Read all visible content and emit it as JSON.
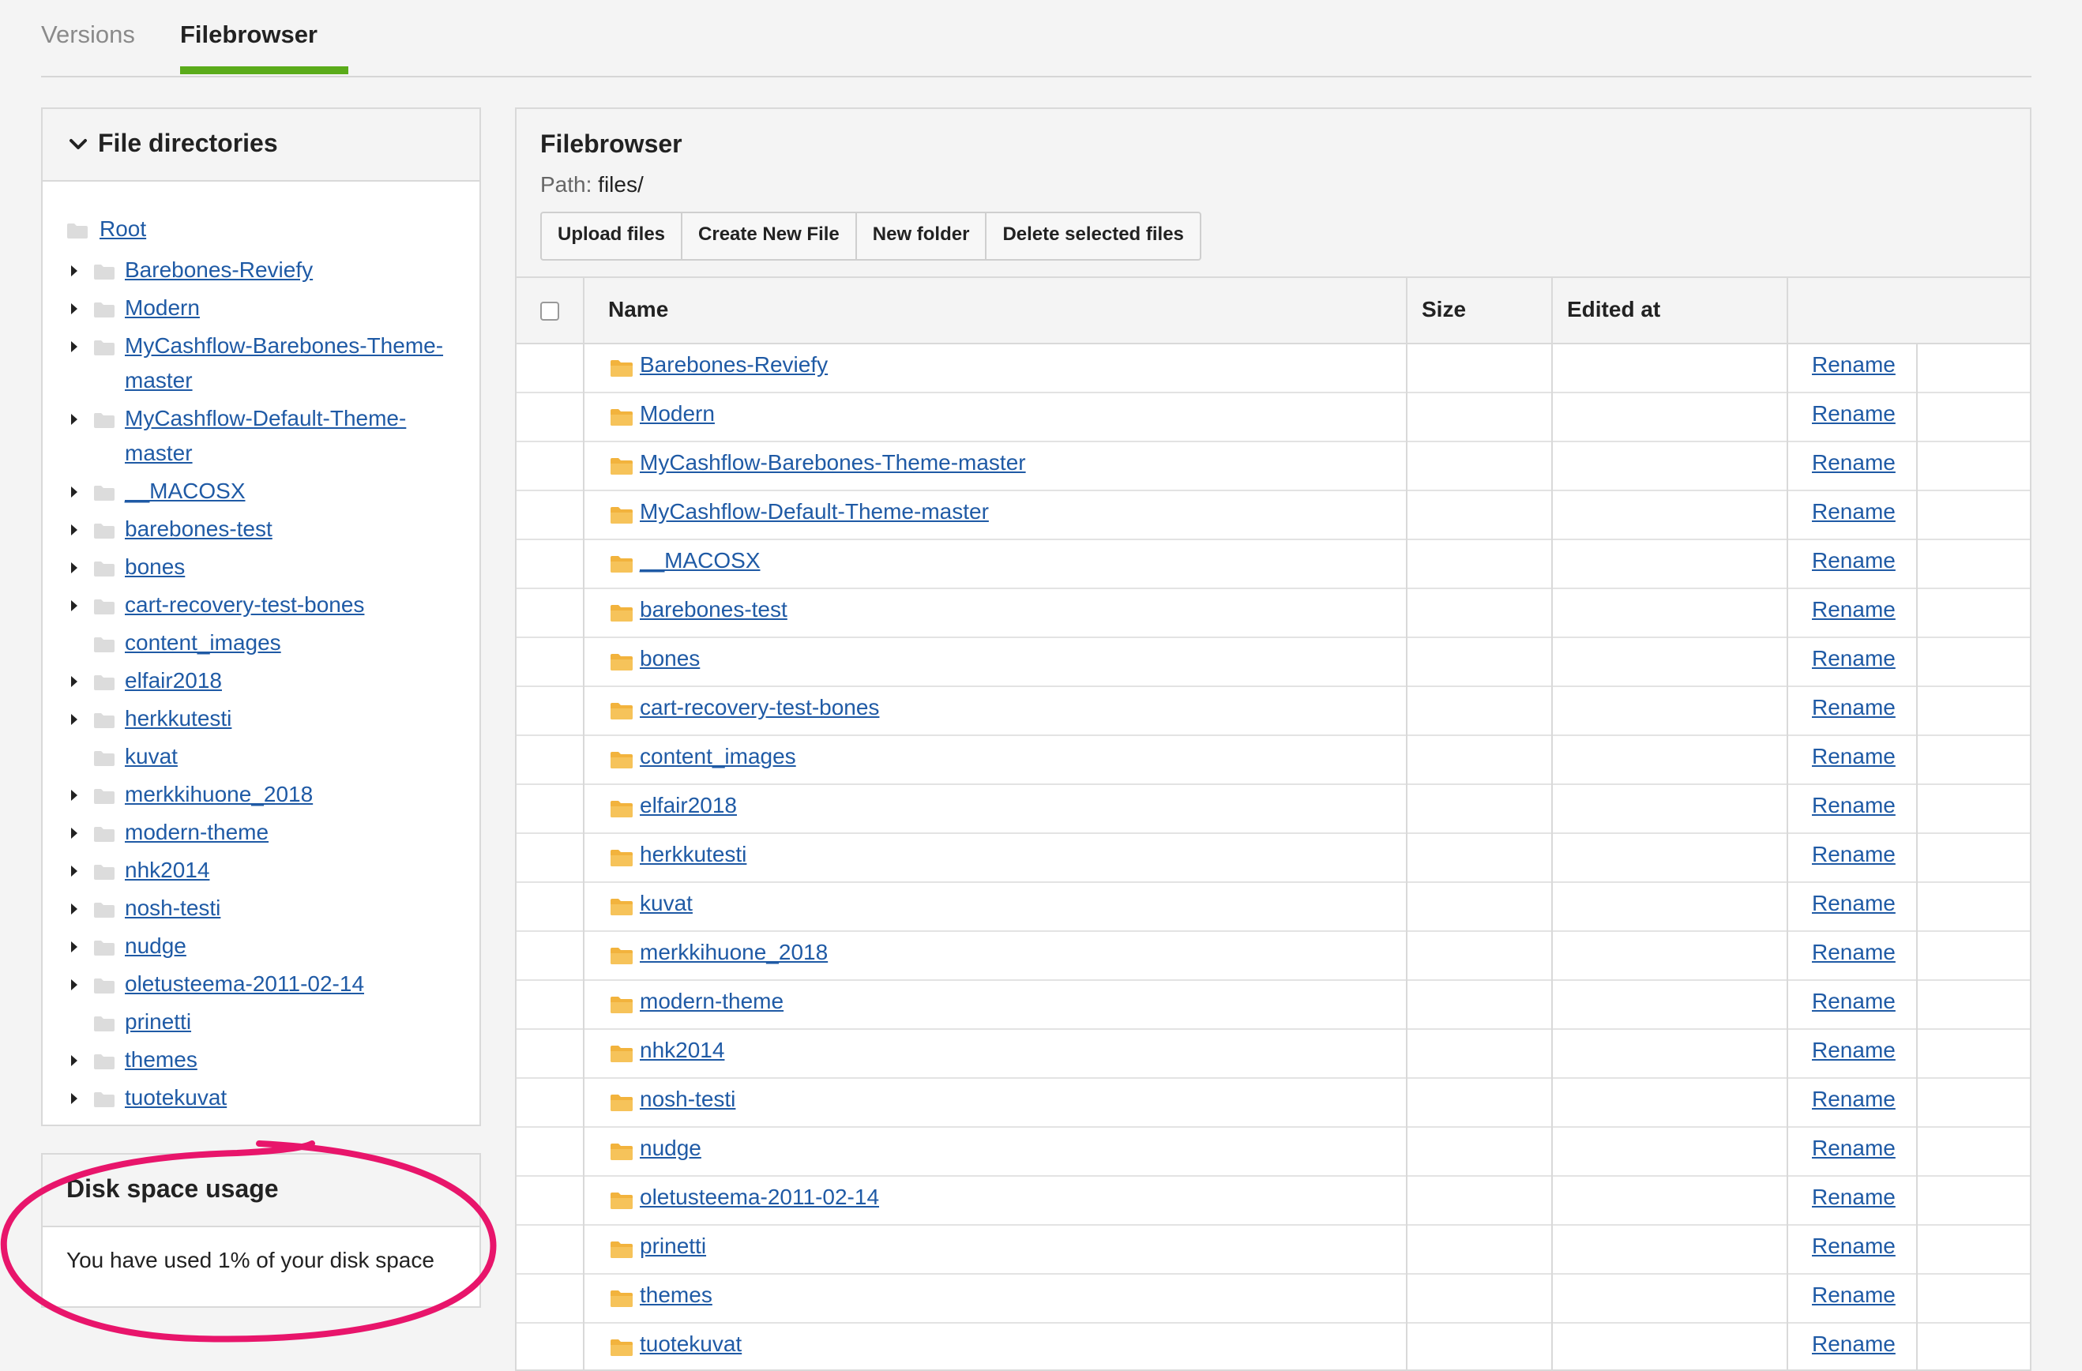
{
  "tabs": [
    {
      "label": "Versions"
    },
    {
      "label": "Filebrowser"
    }
  ],
  "directories": {
    "title": "File directories",
    "root_label": "Root",
    "items": [
      {
        "label": "Barebones-Reviefy",
        "expandable": true
      },
      {
        "label": "Modern",
        "expandable": true
      },
      {
        "label": "MyCashflow-Barebones-Theme-master",
        "expandable": true
      },
      {
        "label": "MyCashflow-Default-Theme-master",
        "expandable": true
      },
      {
        "label": "__MACOSX",
        "expandable": true
      },
      {
        "label": "barebones-test",
        "expandable": true
      },
      {
        "label": "bones",
        "expandable": true
      },
      {
        "label": "cart-recovery-test-bones",
        "expandable": true
      },
      {
        "label": "content_images",
        "expandable": false
      },
      {
        "label": "elfair2018",
        "expandable": true
      },
      {
        "label": "herkkutesti",
        "expandable": true
      },
      {
        "label": "kuvat",
        "expandable": false
      },
      {
        "label": "merkkihuone_2018",
        "expandable": true
      },
      {
        "label": "modern-theme",
        "expandable": true
      },
      {
        "label": "nhk2014",
        "expandable": true
      },
      {
        "label": "nosh-testi",
        "expandable": true
      },
      {
        "label": "nudge",
        "expandable": true
      },
      {
        "label": "oletusteema-2011-02-14",
        "expandable": true
      },
      {
        "label": "prinetti",
        "expandable": false
      },
      {
        "label": "themes",
        "expandable": true
      },
      {
        "label": "tuotekuvat",
        "expandable": true
      }
    ]
  },
  "disk": {
    "title": "Disk space usage",
    "text": "You have used 1% of your disk space"
  },
  "filebrowser": {
    "title": "Filebrowser",
    "path_label": "Path:",
    "path_value": "files/",
    "buttons": {
      "upload": "Upload files",
      "create": "Create New File",
      "new_folder": "New folder",
      "delete": "Delete selected files"
    },
    "columns": {
      "name": "Name",
      "size": "Size",
      "edited": "Edited at"
    },
    "rename_label": "Rename",
    "rows": [
      "Barebones-Reviefy",
      "Modern",
      "MyCashflow-Barebones-Theme-master",
      "MyCashflow-Default-Theme-master",
      "__MACOSX",
      "barebones-test",
      "bones",
      "cart-recovery-test-bones",
      "content_images",
      "elfair2018",
      "herkkutesti",
      "kuvat",
      "merkkihuone_2018",
      "modern-theme",
      "nhk2014",
      "nosh-testi",
      "nudge",
      "oletusteema-2011-02-14",
      "prinetti",
      "themes",
      "tuotekuvat"
    ]
  },
  "colors": {
    "accent": "#5aab1a",
    "link": "#1f5aa5",
    "highlight": "#e8156b",
    "folder": "#f2b33d"
  }
}
